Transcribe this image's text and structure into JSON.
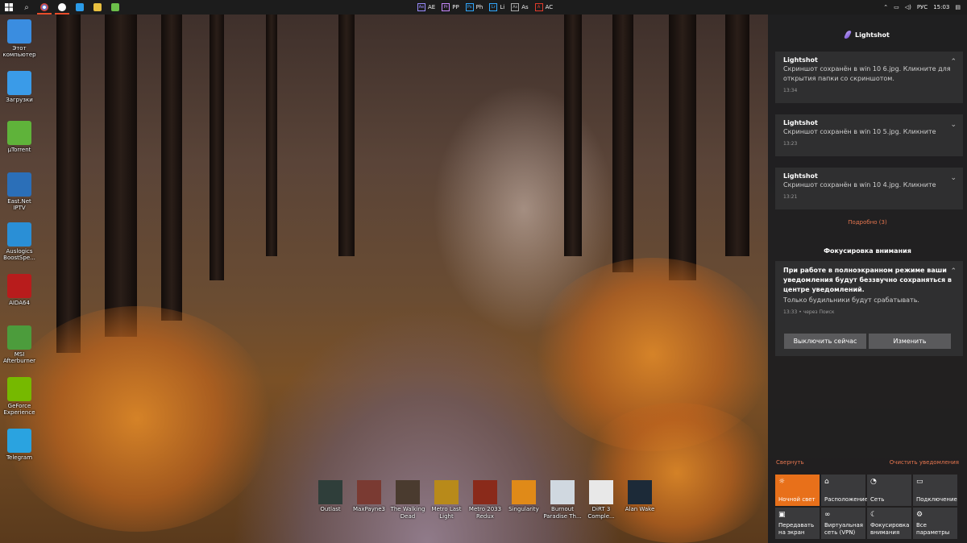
{
  "taskbar": {
    "adobe_apps": [
      {
        "badge": "Ae",
        "label": "AE",
        "color": "#9a8cff"
      },
      {
        "badge": "Pr",
        "label": "PP",
        "color": "#c889ff"
      },
      {
        "badge": "Ps",
        "label": "Ph",
        "color": "#31a8ff"
      },
      {
        "badge": "Lr",
        "label": "Li",
        "color": "#31a8ff"
      },
      {
        "badge": "As",
        "label": "As",
        "color": "#aaaaaa"
      },
      {
        "badge": "A",
        "label": "AC",
        "color": "#e13b2b"
      }
    ],
    "language": "РУС",
    "clock": "15:03"
  },
  "desktop_icons": [
    {
      "label": "Этот компьютер",
      "icon": "computer-icon",
      "color": "#3a8de0"
    },
    {
      "label": "Загрузки",
      "icon": "downloads-icon",
      "color": "#3a9be8"
    },
    {
      "label": "µTorrent",
      "icon": "utorrent-icon",
      "color": "#5fb33a"
    },
    {
      "label": "East.Net IPTV",
      "icon": "iptv-icon",
      "color": "#2b6fb8"
    },
    {
      "label": "Auslogics BoostSpe...",
      "icon": "auslogics-icon",
      "color": "#2a8fd6"
    },
    {
      "label": "AIDA64",
      "icon": "aida64-icon",
      "color": "#b81c1c"
    },
    {
      "label": "MSI Afterburner",
      "icon": "afterburner-icon",
      "color": "#4c9c3c"
    },
    {
      "label": "GeForce Experience",
      "icon": "geforce-icon",
      "color": "#76b900"
    },
    {
      "label": "Telegram",
      "icon": "telegram-icon",
      "color": "#2aa3e0"
    }
  ],
  "games": [
    {
      "label": "Outlast",
      "color": "#2f3e3a"
    },
    {
      "label": "MaxPayne3",
      "color": "#7a3a32"
    },
    {
      "label": "The Walking Dead",
      "color": "#4a3b2f"
    },
    {
      "label": "Metro Last Light",
      "color": "#b88a1a"
    },
    {
      "label": "Metro 2033 Redux",
      "color": "#8a2a1a"
    },
    {
      "label": "Singularity",
      "color": "#e08a18"
    },
    {
      "label": "Burnout Paradise Th...",
      "color": "#d0d8e0"
    },
    {
      "label": "DiRT 3 Comple...",
      "color": "#e8e8e8"
    },
    {
      "label": "Alan Wake",
      "color": "#1c2a38"
    }
  ],
  "action_center": {
    "app_name": "Lightshot",
    "notifications": [
      {
        "title": "Lightshot",
        "body": "Скриншот сохранён в win 10 6.jpg. Кликните для открытия папки со скриншотом.",
        "time": "13:34",
        "chevron": "up"
      },
      {
        "title": "Lightshot",
        "body": "Скриншот сохранён в win 10 5.jpg. Кликните",
        "time": "13:23",
        "chevron": "down"
      },
      {
        "title": "Lightshot",
        "body": "Скриншот сохранён в win 10 4.jpg. Кликните",
        "time": "13:21",
        "chevron": "down"
      }
    ],
    "more_link": "Подробно (3)",
    "focus": {
      "header": "Фокусировка внимания",
      "title": "При работе в полноэкранном режиме ваши уведомления будут беззвучно сохраняться в центре уведомлений.",
      "body": "Только будильники будут срабатывать.",
      "meta": "13:33 • через Поиск",
      "button_disable": "Выключить сейчас",
      "button_change": "Изменить"
    },
    "collapse_label": "Свернуть",
    "clear_label": "Очистить уведомления",
    "tiles": [
      {
        "label": "Ночной свет",
        "icon": "☼",
        "active": true
      },
      {
        "label": "Расположение",
        "icon": "⌂",
        "active": false
      },
      {
        "label": "Сеть",
        "icon": "◔",
        "active": false
      },
      {
        "label": "Подключение",
        "icon": "▭",
        "active": false
      },
      {
        "label": "Передавать на экран",
        "icon": "▣",
        "active": false
      },
      {
        "label": "Виртуальная сеть (VPN)",
        "icon": "∞",
        "active": false
      },
      {
        "label": "Фокусировка внимания",
        "icon": "☾",
        "active": false
      },
      {
        "label": "Все параметры",
        "icon": "⚙",
        "active": false
      }
    ],
    "accent_color": "#e8701a"
  }
}
